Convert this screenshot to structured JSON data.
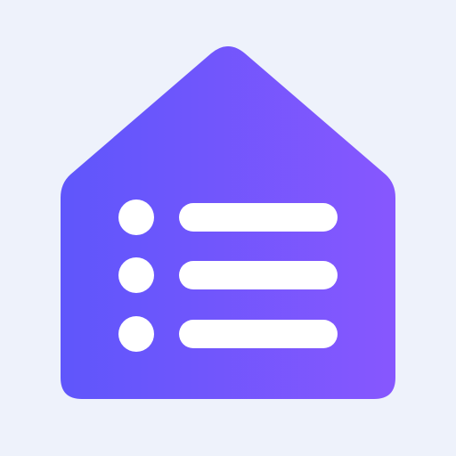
{
  "background_color": "#EEF2FB",
  "icon": {
    "name": "house-list-icon",
    "gradient_start": "#5F56FB",
    "gradient_end": "#8757FE",
    "foreground_color": "#FFFFFF",
    "list_rows": 3
  }
}
